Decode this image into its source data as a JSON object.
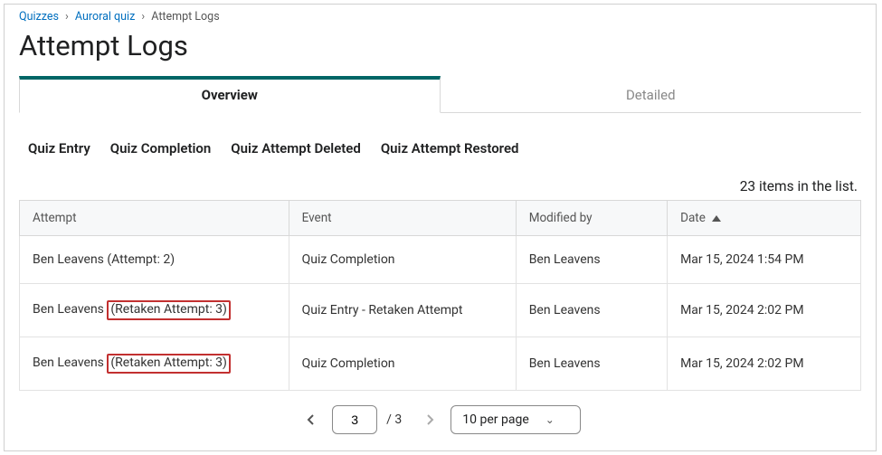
{
  "breadcrumb": {
    "items": [
      {
        "label": "Quizzes",
        "link": true
      },
      {
        "label": "Auroral quiz",
        "link": true
      },
      {
        "label": "Attempt Logs",
        "link": false
      }
    ]
  },
  "page_title": "Attempt Logs",
  "tabs": {
    "overview": "Overview",
    "detailed": "Detailed"
  },
  "filters": {
    "entry": "Quiz Entry",
    "completion": "Quiz Completion",
    "deleted": "Quiz Attempt Deleted",
    "restored": "Quiz Attempt Restored"
  },
  "list_count": "23 items in the list.",
  "table": {
    "headers": {
      "attempt": "Attempt",
      "event": "Event",
      "modified_by": "Modified by",
      "date": "Date"
    },
    "rows": [
      {
        "attempt_prefix": "Ben Leavens ",
        "attempt_suffix": "(Attempt: 2)",
        "attempt_highlight": false,
        "event": "Quiz Completion",
        "modified_by": "Ben Leavens",
        "date": "Mar 15, 2024 1:54 PM"
      },
      {
        "attempt_prefix": "Ben Leavens ",
        "attempt_suffix": "(Retaken Attempt: 3)",
        "attempt_highlight": true,
        "event": "Quiz Entry - Retaken Attempt",
        "modified_by": "Ben Leavens",
        "date": "Mar 15, 2024 2:02 PM"
      },
      {
        "attempt_prefix": "Ben Leavens ",
        "attempt_suffix": "(Retaken Attempt: 3)",
        "attempt_highlight": true,
        "event": "Quiz Completion",
        "modified_by": "Ben Leavens",
        "date": "Mar 15, 2024 2:02 PM"
      }
    ]
  },
  "pagination": {
    "current": "3",
    "total": "/ 3",
    "per_page": "10 per page"
  }
}
